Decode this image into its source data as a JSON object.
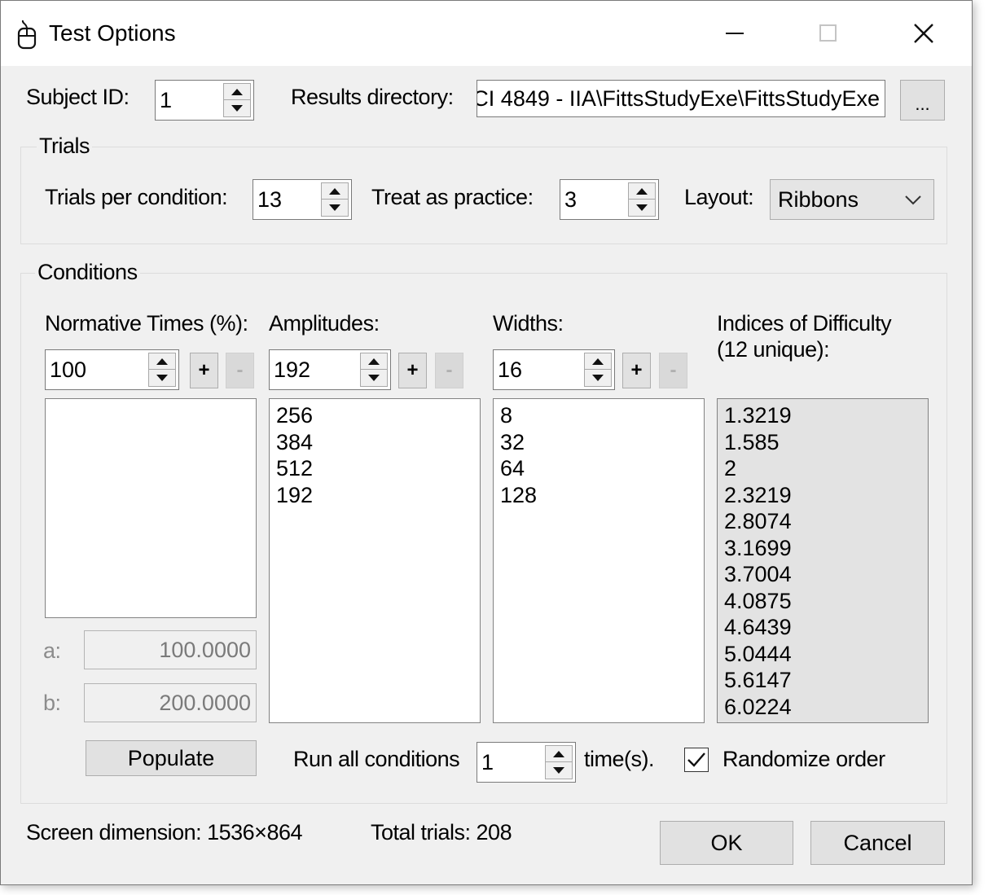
{
  "window": {
    "title": "Test Options",
    "minimize_icon": "minimize-icon",
    "maximize_icon": "maximize-icon",
    "close_icon": "close-icon"
  },
  "subject": {
    "label": "Subject ID:",
    "value": "1"
  },
  "results": {
    "label": "Results directory:",
    "value": "CI 4849 - IIA\\FittsStudyExe\\FittsStudyExe",
    "browse_label": "..."
  },
  "trials": {
    "group_title": "Trials",
    "per_condition_label": "Trials per condition:",
    "per_condition_value": "13",
    "practice_label": "Treat as practice:",
    "practice_value": "3",
    "layout_label": "Layout:",
    "layout_value": "Ribbons"
  },
  "conditions": {
    "group_title": "Conditions",
    "normative": {
      "label": "Normative Times (%):",
      "value": "100",
      "add_label": "+",
      "remove_label": "-",
      "items": []
    },
    "amplitudes": {
      "label": "Amplitudes:",
      "value": "192",
      "add_label": "+",
      "remove_label": "-",
      "items": [
        "256",
        "384",
        "512",
        "192"
      ]
    },
    "widths": {
      "label": "Widths:",
      "value": "16",
      "add_label": "+",
      "remove_label": "-",
      "items": [
        "8",
        "32",
        "64",
        "128"
      ]
    },
    "indices": {
      "label_line1": "Indices of Difficulty",
      "label_line2": "(12 unique):",
      "items": [
        "1.3219",
        "1.585",
        "2",
        "2.3219",
        "2.8074",
        "3.1699",
        "3.7004",
        "4.0875",
        "4.6439",
        "5.0444",
        "5.6147",
        "6.0224"
      ]
    },
    "a_label": "a:",
    "a_value": "100.0000",
    "b_label": "b:",
    "b_value": "200.0000",
    "populate_label": "Populate",
    "run_all_label": "Run all conditions",
    "run_all_value": "1",
    "times_label": "time(s).",
    "randomize_label": "Randomize order",
    "randomize_checked": true
  },
  "footer": {
    "screen_dimension": "Screen dimension: 1536×864",
    "total_trials": "Total trials: 208",
    "ok_label": "OK",
    "cancel_label": "Cancel"
  }
}
